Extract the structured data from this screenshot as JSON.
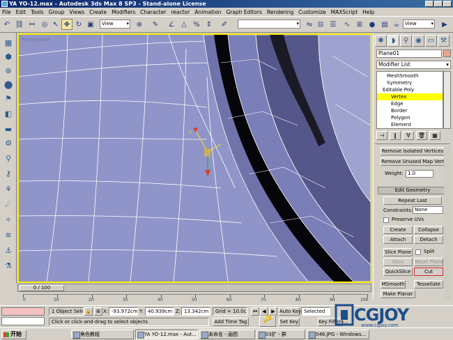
{
  "window": {
    "title": "YA YO-12.max - Autodesk 3ds Max 8 SP3 - Stand-alone License"
  },
  "menu": [
    "File",
    "Edit",
    "Tools",
    "Group",
    "Views",
    "Create",
    "Modifiers",
    "Character",
    "reactor",
    "Animation",
    "Graph Editors",
    "Rendering",
    "Customize",
    "MAXScript",
    "Help"
  ],
  "toolbar": {
    "ref_coord": "View",
    "named_selection": "",
    "right_view": "View"
  },
  "viewport": {
    "label": "Perspective"
  },
  "command_panel": {
    "object_name": "Plane01",
    "modifier_list": "Modifier List",
    "stack": [
      "MeshSmooth",
      "Symmetry",
      "Editable Poly",
      "Vertex",
      "Edge",
      "Border",
      "Polygon",
      "Element"
    ],
    "stack_selected": "Vertex",
    "buttons": {
      "remove_isolated": "Remove Isolated Vertices",
      "remove_unused": "Remove Unused Map Verts",
      "weight_label": "Weight:",
      "weight_value": "1.0",
      "edit_geometry": "Edit Geometry",
      "repeat_last": "Repeat Last",
      "constraints_label": "Constraints:",
      "constraints_value": "None",
      "preserve_uvs": "Preserve UVs",
      "create": "Create",
      "collapse": "Collapse",
      "attach": "Attach",
      "detach": "Detach",
      "slice_plane": "Slice Plane",
      "split": "Split",
      "slice": "Slice",
      "reset_plane": "Reset Plane",
      "quickslice": "QuickSlice",
      "cut": "Cut",
      "msmooth": "MSmooth",
      "tessellate": "Tessellate",
      "make_planar": "Make Planar"
    }
  },
  "timeline": {
    "slider": "0 / 100",
    "ticks": [
      "0",
      "10",
      "20",
      "30",
      "40",
      "50",
      "60",
      "70",
      "80",
      "90",
      "100"
    ]
  },
  "status": {
    "selection": "1 Object Sele",
    "x_label": "X:",
    "x_value": "-93.972cm",
    "y_label": "Y:",
    "y_value": "40.939cm",
    "z_label": "Z:",
    "z_value": "13.342cm",
    "grid": "Grid = 10.0cm",
    "prompt": "Click or click-and-drag to select objects",
    "add_time_tag": "Add Time Tag",
    "auto_key": "Auto Key",
    "set_key": "Set Key",
    "key_mode": "Selected",
    "key_filters": "Key Filters..."
  },
  "logo": {
    "text": "CGJOY",
    "url": "www.cgjoy.com"
  },
  "taskbar": {
    "start": "开始",
    "tasks": [
      "角色教程",
      "YA YO-12.max - Aut...",
      "未命名 - 画图",
      "03扩 - 群",
      "046.JPG - Windows..."
    ]
  },
  "colors": {
    "viewport_bg": "#8f95c8",
    "viewport_border": "#f6e600",
    "selected_stack": "#ffff00",
    "titlebar": "#0a246a"
  }
}
